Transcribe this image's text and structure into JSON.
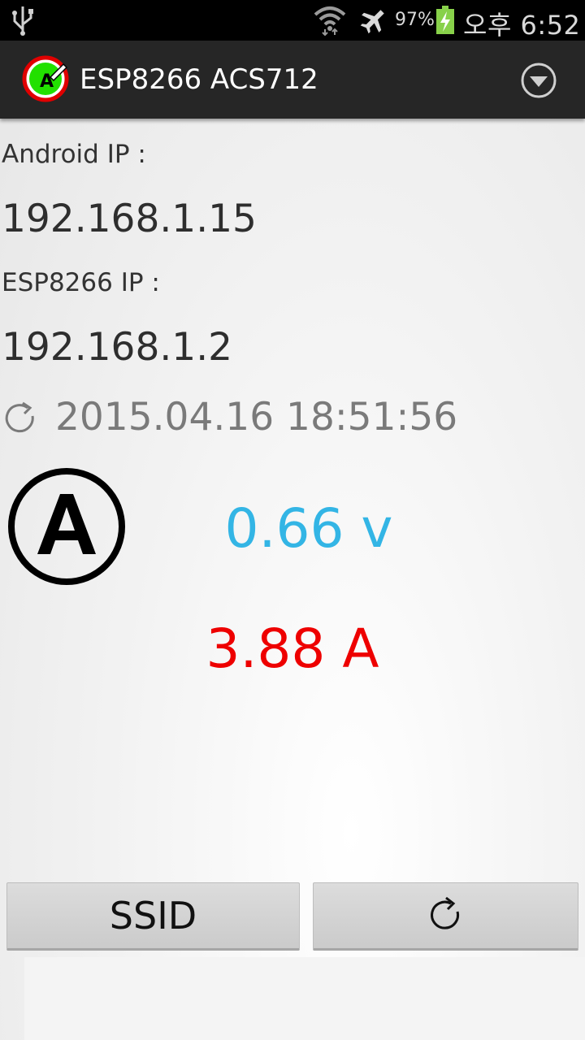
{
  "status_bar": {
    "battery_percent": "97%",
    "time": "오후 6:52",
    "icons": [
      "usb-icon",
      "wifi-icon",
      "airplane-mode-icon",
      "battery-charging-icon"
    ]
  },
  "action_bar": {
    "title": "ESP8266 ACS712",
    "logo_letter": "A",
    "menu_icon": "overflow-menu-icon"
  },
  "main": {
    "android_ip_label": "Android IP :",
    "android_ip": "192.168.1.15",
    "esp_ip_label": "ESP8266 IP :",
    "esp_ip": "192.168.1.2",
    "last_update": "2015.04.16 18:51:56",
    "ammeter_letter": "A",
    "voltage": "0.66 v",
    "current": "3.88 A"
  },
  "buttons": {
    "ssid_label": "SSID",
    "refresh_icon": "refresh-icon"
  },
  "colors": {
    "voltage": "#33b5e5",
    "current": "#ee0000",
    "logo_green": "#22e000",
    "logo_ring": "#e00000"
  }
}
